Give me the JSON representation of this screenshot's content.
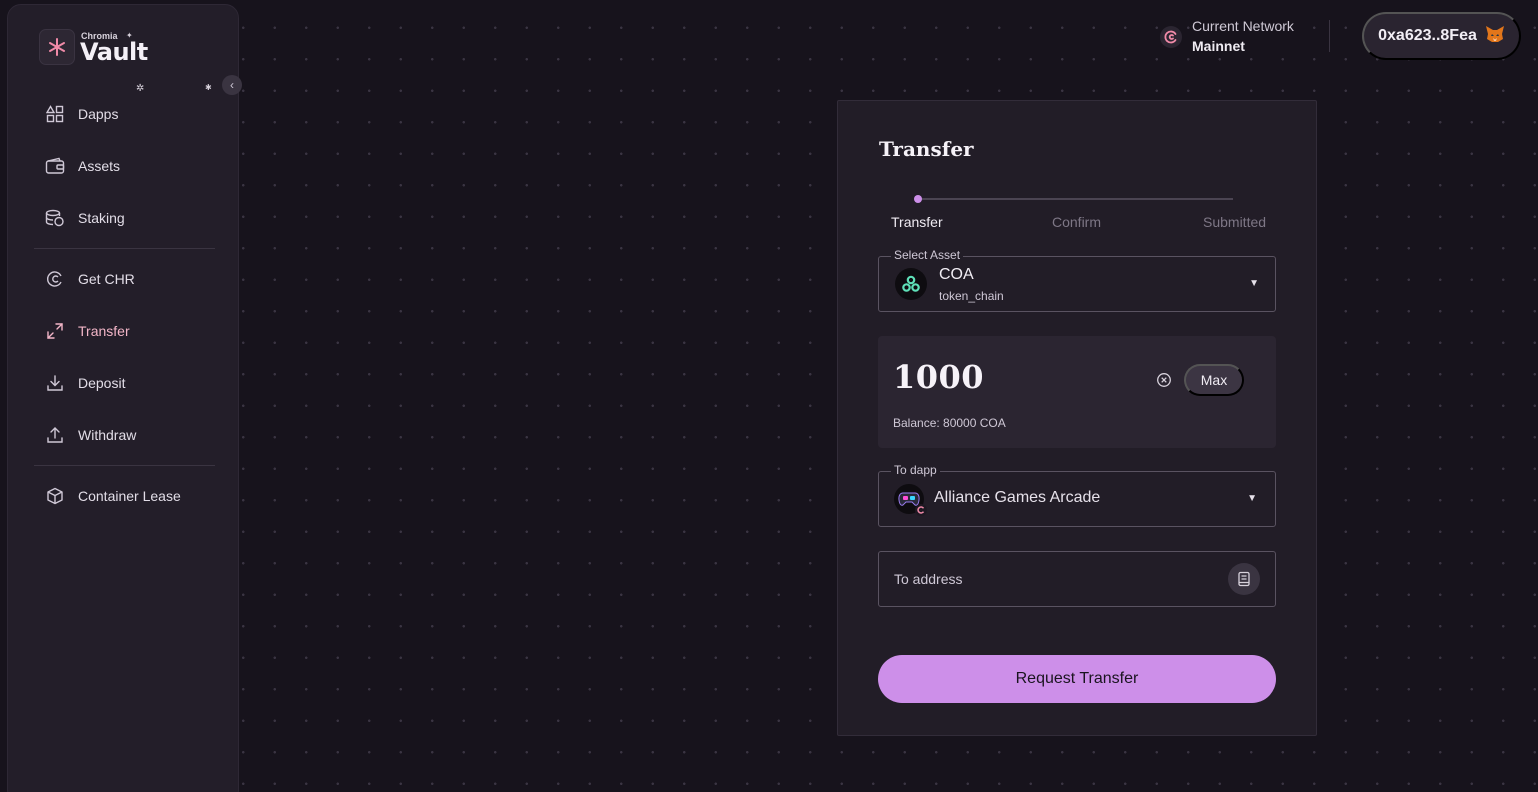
{
  "brand": {
    "name_small": "Chromia",
    "name_large": "Vault"
  },
  "sidebar": {
    "items": [
      {
        "label": "Dapps",
        "icon": "dapps-icon"
      },
      {
        "label": "Assets",
        "icon": "wallet-icon"
      },
      {
        "label": "Staking",
        "icon": "coins-stack-icon"
      },
      {
        "label": "Get CHR",
        "icon": "chr-coin-icon"
      },
      {
        "label": "Transfer",
        "icon": "transfer-arrows-icon",
        "active": true
      },
      {
        "label": "Deposit",
        "icon": "download-icon"
      },
      {
        "label": "Withdraw",
        "icon": "upload-icon"
      },
      {
        "label": "Container Lease",
        "icon": "box-icon"
      }
    ]
  },
  "header": {
    "network_label": "Current Network",
    "network_value": "Mainnet",
    "wallet_address": "0xa623..8Fea"
  },
  "transfer": {
    "title": "Transfer",
    "steps": [
      "Transfer",
      "Confirm",
      "Submitted"
    ],
    "current_step": 0,
    "asset": {
      "legend": "Select Asset",
      "name": "COA",
      "chain": "token_chain"
    },
    "amount": {
      "value": "1000",
      "max_label": "Max",
      "balance": "Balance: 80000 COA"
    },
    "dapp": {
      "legend": "To dapp",
      "name": "Alliance Games Arcade"
    },
    "address": {
      "placeholder": "To address"
    },
    "submit_label": "Request Transfer"
  },
  "colors": {
    "accent": "#cd8fe9",
    "active_nav": "#f3b6c8",
    "background": "#17131c",
    "panel": "#221d27"
  }
}
